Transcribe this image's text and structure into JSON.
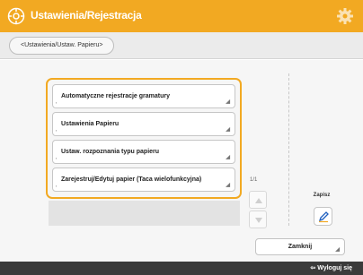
{
  "header": {
    "title": "Ustawienia/Rejestracja",
    "icon": "settings-register-icon",
    "settings_icon": "gear-icon"
  },
  "breadcrumb": {
    "label": "<Ustawienia/Ustaw. Papieru>"
  },
  "menu": {
    "items": [
      {
        "label": "Automatyczne rejestracje gramatury"
      },
      {
        "label": "Ustawienia Papieru"
      },
      {
        "label": "Ustaw. rozpoznania typu papieru"
      },
      {
        "label": "Zarejestruj/Edytuj papier (Taca wielofunkcyjna)"
      }
    ]
  },
  "pager": {
    "page": "1/1"
  },
  "edit": {
    "label": "Zapisz"
  },
  "close": {
    "label": "Zamknij"
  },
  "status": {
    "text": "Wyloguj się"
  },
  "colors": {
    "accent": "#f2a922",
    "status_bar": "#3b3b3b"
  }
}
